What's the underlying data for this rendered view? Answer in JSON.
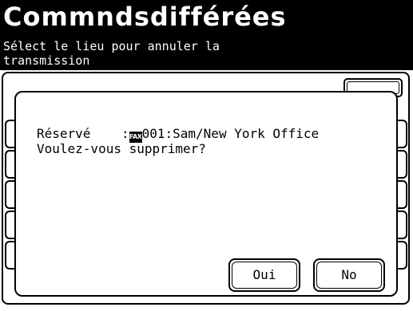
{
  "header": {
    "title": "Commndsdifférées",
    "subtitle_line1": "Sélect le lieu pour annuler la",
    "subtitle_line2": "transmission"
  },
  "dialog": {
    "reserved_label": "Réservé",
    "separator": " :",
    "fax_icon": "fax-icon",
    "destination": "001:Sam/New York Office",
    "question": "Voulez-vous supprimer?",
    "yes_label": "Oui",
    "no_label": "No"
  },
  "colors": {
    "header_bg": "#000000",
    "header_text": "#ffffff",
    "background": "#ffffff"
  }
}
